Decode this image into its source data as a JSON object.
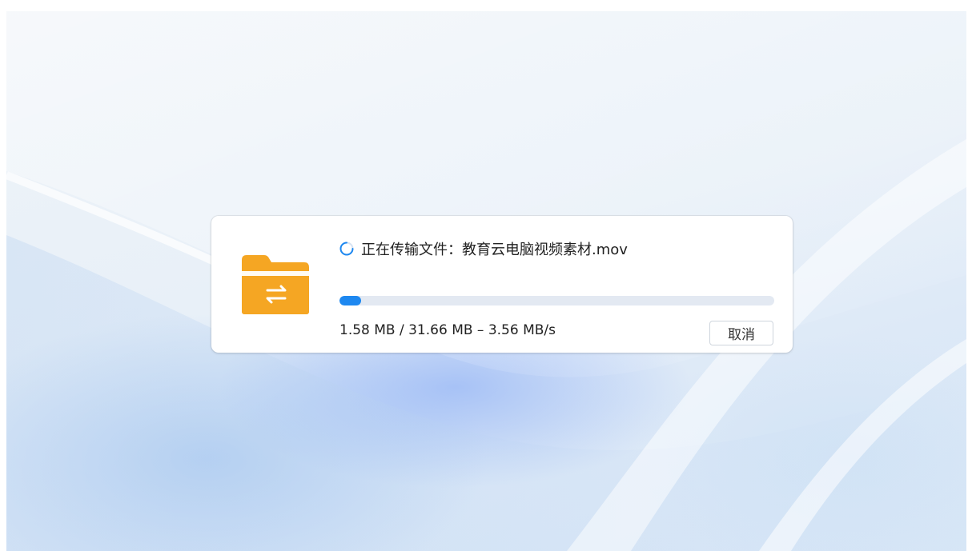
{
  "dialog": {
    "status_prefix": "正在传输文件：",
    "file_name": "教育云电脑视频素材.mov",
    "transferred": "1.58 MB",
    "total": "31.66 MB",
    "speed": "3.56 MB/s",
    "stats_text": "1.58 MB / 31.66 MB – 3.56 MB/s",
    "progress_fraction": 0.05,
    "cancel_label": "取消",
    "icons": {
      "folder": "folder-transfer-icon",
      "spinner": "loading-spinner-icon"
    }
  },
  "colors": {
    "accent": "#1e88f0",
    "folder": "#f5a623",
    "track": "#e3e9f2"
  }
}
